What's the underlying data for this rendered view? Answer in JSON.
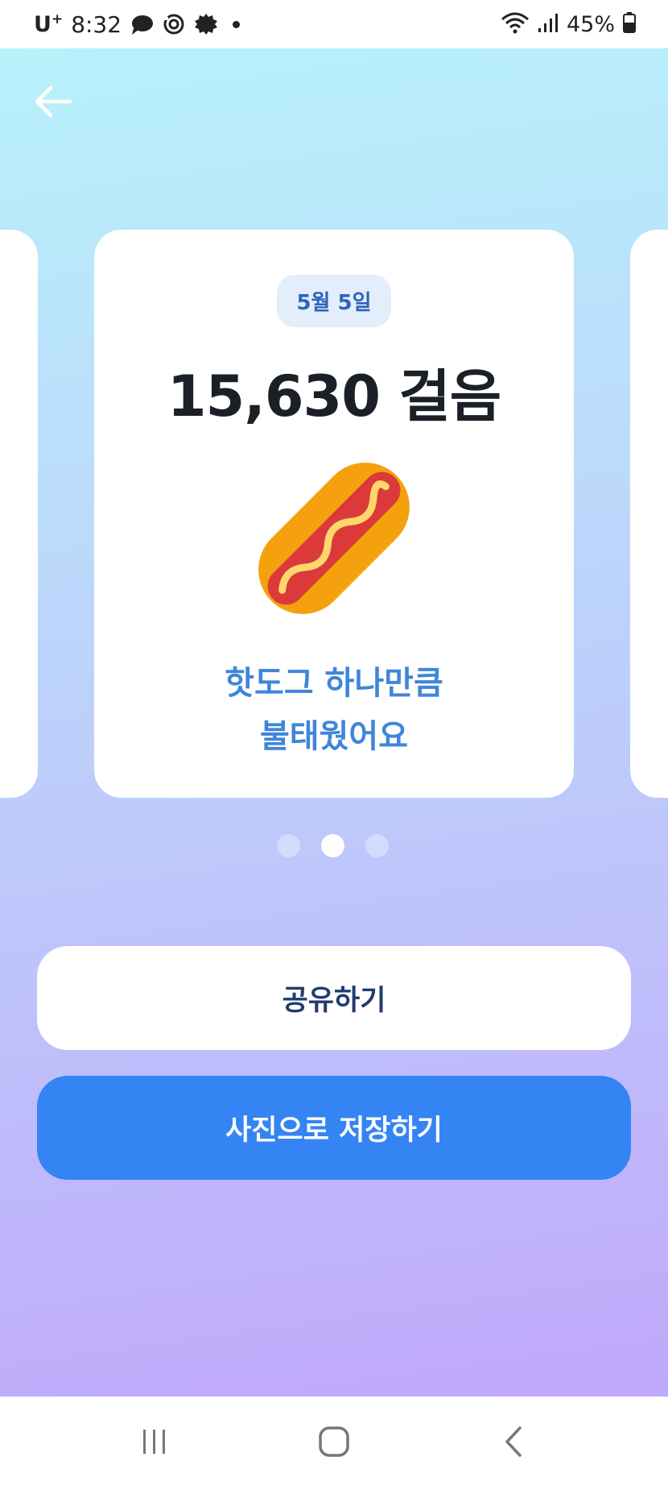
{
  "status_bar": {
    "carrier": "U",
    "carrier_sup": "+",
    "time": "8:32",
    "battery": "45%",
    "icons": [
      "chat-bubble-icon",
      "sync-icon",
      "settings-badge-icon",
      "notification-dot-icon",
      "wifi-icon",
      "signal-icon",
      "battery-icon"
    ]
  },
  "header": {
    "back_icon": "arrow-left-icon"
  },
  "card": {
    "date": "5월 5일",
    "steps": "15,630 걸음",
    "illustration": "hotdog-icon",
    "message_line1": "핫도그 하나만큼",
    "message_line2": "불태웠어요"
  },
  "pager": {
    "count": 3,
    "active_index": 1
  },
  "actions": {
    "share_label": "공유하기",
    "save_label": "사진으로 저장하기"
  },
  "colors": {
    "accent": "#3484f3",
    "date_text": "#2d64b8",
    "message_text": "#3f86d8",
    "steps_text": "#1b2027"
  },
  "nav_bar": {
    "icons": [
      "recent-apps-icon",
      "home-icon",
      "back-icon"
    ]
  }
}
